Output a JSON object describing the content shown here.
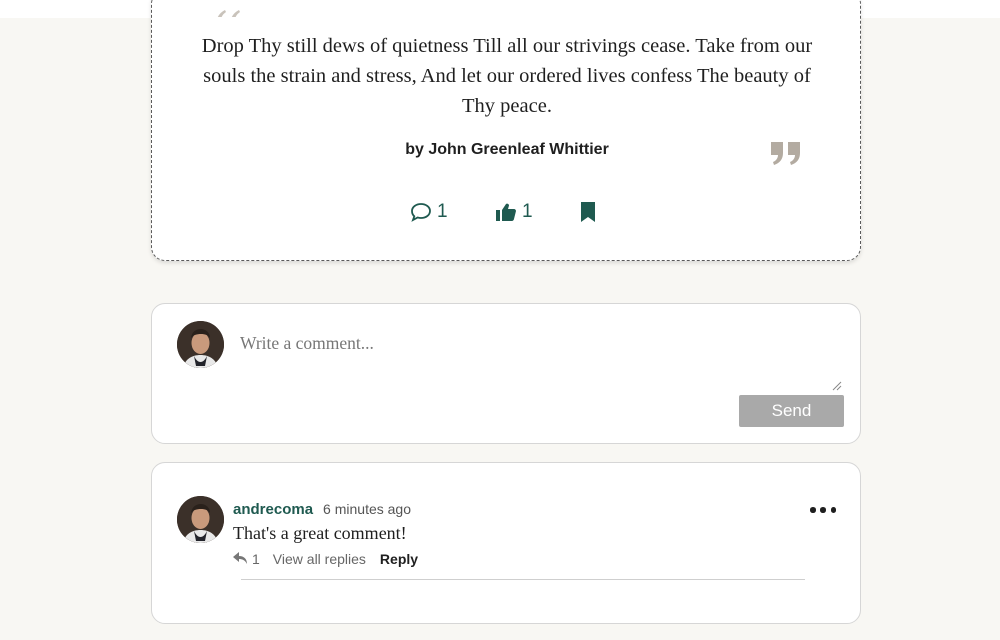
{
  "quote": {
    "text": "Drop Thy still dews of quietness Till all our strivings cease. Take from our souls the strain and stress, And let our ordered lives confess The beauty of Thy peace.",
    "author": "by John Greenleaf Whittier",
    "comments_count": "1",
    "likes_count": "1"
  },
  "composer": {
    "placeholder": "Write a comment...",
    "send_label": "Send"
  },
  "comment": {
    "author": "andrecoma",
    "time": "6 minutes ago",
    "body": "That's a great comment!",
    "reply_count": "1",
    "view_replies_label": "View all replies",
    "reply_label": "Reply"
  },
  "colors": {
    "accent": "#1f5a50",
    "quote_mark": "#b3aba1",
    "send_disabled": "#a9a9a9",
    "background": "#f8f7f3"
  },
  "icons": [
    "quote-open-icon",
    "quote-close-icon",
    "comment-icon",
    "thumbs-up-icon",
    "bookmark-icon",
    "reply-icon",
    "more-icon"
  ]
}
